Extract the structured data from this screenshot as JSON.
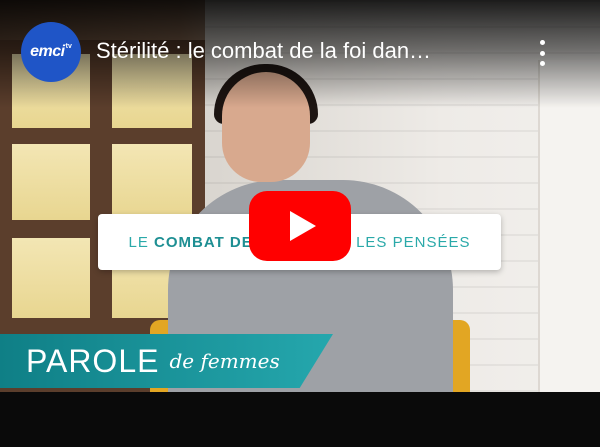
{
  "video": {
    "title": "Stérilité : le combat de la foi dan…",
    "channel_avatar_text": "emci",
    "channel_avatar_sup": "tv"
  },
  "overlay": {
    "caption_prefix": "LE ",
    "caption_bold": "COMBAT DE L",
    "caption_suffix": "NS LES PENSÉES",
    "banner_main": "PAROLE",
    "banner_sub": "de femmes"
  },
  "icons": {
    "play": "play-icon",
    "more": "kebab-menu-icon"
  },
  "colors": {
    "play_button": "#ff0000",
    "avatar": "#1f55c7",
    "banner": "#1e9ca3"
  }
}
